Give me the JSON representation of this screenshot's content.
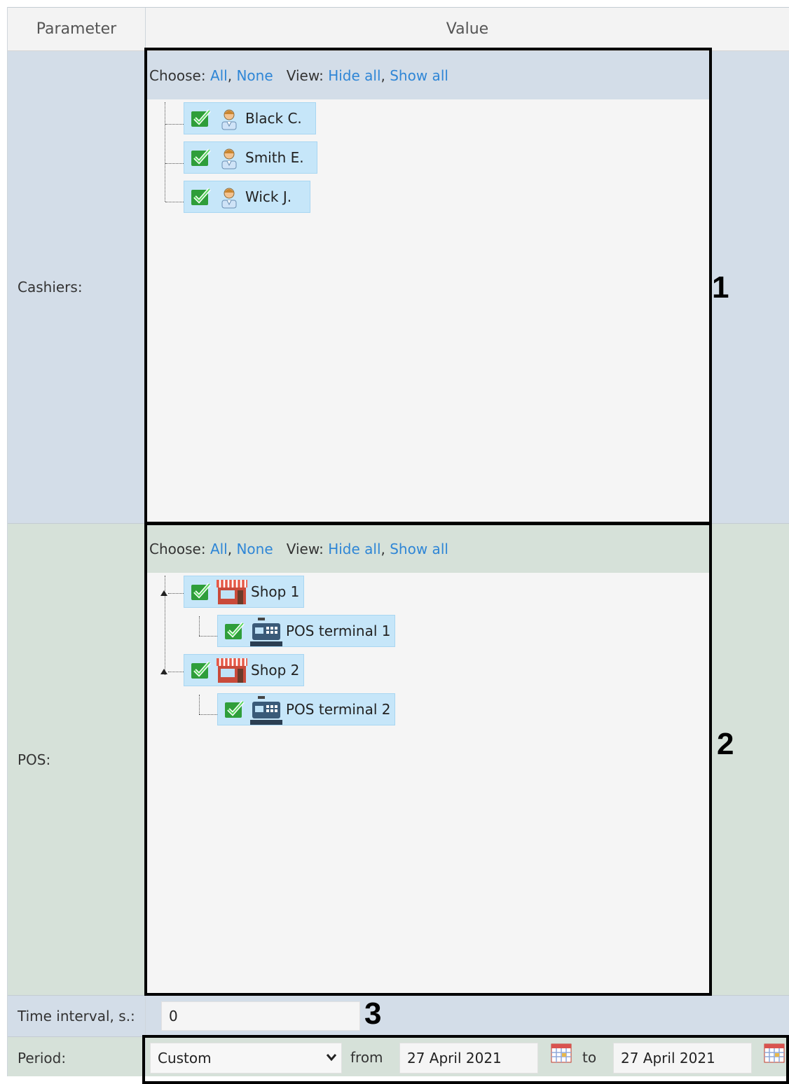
{
  "table": {
    "header_parameter": "Parameter",
    "header_value": "Value"
  },
  "cashiers": {
    "label": "Cashiers:",
    "choose_label": "Choose:",
    "choose_all": "All",
    "choose_none": "None",
    "view_label": "View:",
    "view_hide_all": "Hide all",
    "view_show_all": "Show all",
    "items": [
      {
        "label": "Black C.",
        "checked": true,
        "icon": "cashier-icon"
      },
      {
        "label": "Smith E.",
        "checked": true,
        "icon": "cashier-icon"
      },
      {
        "label": "Wick J.",
        "checked": true,
        "icon": "cashier-icon"
      }
    ]
  },
  "pos": {
    "label": "POS:",
    "choose_label": "Choose:",
    "choose_all": "All",
    "choose_none": "None",
    "view_label": "View:",
    "view_hide_all": "Hide all",
    "view_show_all": "Show all",
    "shops": [
      {
        "label": "Shop 1",
        "checked": true,
        "icon": "shop-icon",
        "terminals": [
          {
            "label": "POS terminal 1",
            "checked": true,
            "icon": "pos-terminal-icon"
          }
        ]
      },
      {
        "label": "Shop 2",
        "checked": true,
        "icon": "shop-icon",
        "terminals": [
          {
            "label": "POS terminal 2",
            "checked": true,
            "icon": "pos-terminal-icon"
          }
        ]
      }
    ]
  },
  "time_interval": {
    "label": "Time interval, s.:",
    "value": "0"
  },
  "period": {
    "label": "Period:",
    "selected": "Custom",
    "from_label": "from",
    "from_value": "27 April 2021",
    "to_label": "to",
    "to_value": "27 April 2021"
  },
  "markers": [
    "1",
    "2",
    "3"
  ],
  "colors": {
    "link": "#2f86d6",
    "node_bg": "#c6e6f9",
    "check": "#3bb33b",
    "cashiers_band": "#d3dde8",
    "pos_band": "#d6e1d9"
  }
}
